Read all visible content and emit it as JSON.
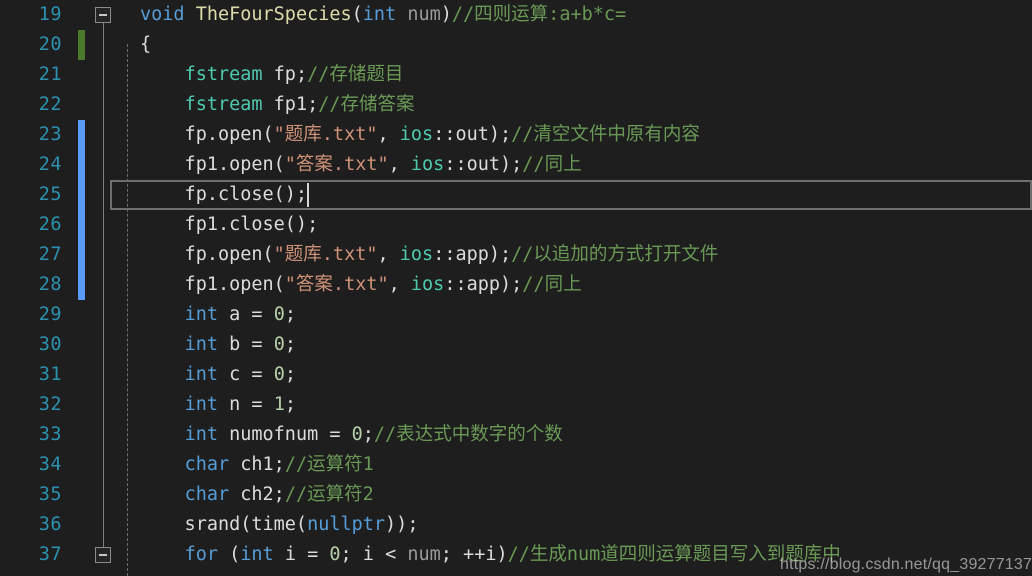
{
  "editor": {
    "theme_name": "dark",
    "background_color": "#1e1e1e",
    "line_number_color": "#2b91af",
    "comment_color": "#6a9955",
    "keyword_color": "#569cd6",
    "string_color": "#ce9178",
    "type_color": "#4ec9b0",
    "number_color": "#b5cea8",
    "change_bar_added_color": "#4b7a2c",
    "change_bar_modified_color": "#5b9bf8",
    "current_line_number": "25",
    "first_visible_line": "19",
    "last_visible_line": "37"
  },
  "gutter": {
    "line_numbers": [
      "19",
      "20",
      "21",
      "22",
      "23",
      "24",
      "25",
      "26",
      "27",
      "28",
      "29",
      "30",
      "31",
      "32",
      "33",
      "34",
      "35",
      "36",
      "37"
    ],
    "fold_markers": [
      {
        "line": "19",
        "state": "expanded",
        "glyph": "minus"
      },
      {
        "line": "37",
        "state": "expanded",
        "glyph": "minus"
      }
    ],
    "change_bars": [
      {
        "line": "20",
        "kind": "added",
        "color": "#4b7a2c"
      },
      {
        "line": "23",
        "kind": "modified",
        "color": "#5b9bf8"
      },
      {
        "line": "24",
        "kind": "modified",
        "color": "#5b9bf8"
      },
      {
        "line": "25",
        "kind": "modified",
        "color": "#5b9bf8"
      },
      {
        "line": "26",
        "kind": "modified",
        "color": "#5b9bf8"
      },
      {
        "line": "27",
        "kind": "modified",
        "color": "#5b9bf8"
      },
      {
        "line": "28",
        "kind": "modified",
        "color": "#5b9bf8"
      }
    ]
  },
  "code": {
    "lines": [
      {
        "number": "19",
        "text": "void TheFourSpecies(int num)//四则运算:a+b*c=",
        "tokens": [
          {
            "t": "void",
            "c": "kw"
          },
          {
            "t": " ",
            "c": "pun"
          },
          {
            "t": "TheFourSpecies",
            "c": "fn"
          },
          {
            "t": "(",
            "c": "pun"
          },
          {
            "t": "int",
            "c": "kw"
          },
          {
            "t": " ",
            "c": "pun"
          },
          {
            "t": "num",
            "c": "par"
          },
          {
            "t": ")",
            "c": "pun"
          },
          {
            "t": "//四则运算:a+b*c=",
            "c": "cmt"
          }
        ]
      },
      {
        "number": "20",
        "text": "{",
        "tokens": [
          {
            "t": "{",
            "c": "pun"
          }
        ]
      },
      {
        "number": "21",
        "text": "    fstream fp;//存储题目",
        "tokens": [
          {
            "t": "    ",
            "c": "pun"
          },
          {
            "t": "fstream",
            "c": "typ"
          },
          {
            "t": " fp;",
            "c": "pun"
          },
          {
            "t": "//存储题目",
            "c": "cmt"
          }
        ]
      },
      {
        "number": "22",
        "text": "    fstream fp1;//存储答案",
        "tokens": [
          {
            "t": "    ",
            "c": "pun"
          },
          {
            "t": "fstream",
            "c": "typ"
          },
          {
            "t": " fp1;",
            "c": "pun"
          },
          {
            "t": "//存储答案",
            "c": "cmt"
          }
        ]
      },
      {
        "number": "23",
        "text": "    fp.open(\"题库.txt\", ios::out);//清空文件中原有内容",
        "tokens": [
          {
            "t": "    fp.open(",
            "c": "pun"
          },
          {
            "t": "\"题库.txt\"",
            "c": "str"
          },
          {
            "t": ", ",
            "c": "pun"
          },
          {
            "t": "ios",
            "c": "typ"
          },
          {
            "t": "::out);",
            "c": "pun"
          },
          {
            "t": "//清空文件中原有内容",
            "c": "cmt"
          }
        ]
      },
      {
        "number": "24",
        "text": "    fp1.open(\"答案.txt\", ios::out);//同上",
        "tokens": [
          {
            "t": "    fp1.open(",
            "c": "pun"
          },
          {
            "t": "\"答案.txt\"",
            "c": "str"
          },
          {
            "t": ", ",
            "c": "pun"
          },
          {
            "t": "ios",
            "c": "typ"
          },
          {
            "t": "::out);",
            "c": "pun"
          },
          {
            "t": "//同上",
            "c": "cmt"
          }
        ]
      },
      {
        "number": "25",
        "text": "    fp.close();",
        "tokens": [
          {
            "t": "    fp.close();",
            "c": "pun"
          }
        ]
      },
      {
        "number": "26",
        "text": "    fp1.close();",
        "tokens": [
          {
            "t": "    fp1.close();",
            "c": "pun"
          }
        ]
      },
      {
        "number": "27",
        "text": "    fp.open(\"题库.txt\", ios::app);//以追加的方式打开文件",
        "tokens": [
          {
            "t": "    fp.open(",
            "c": "pun"
          },
          {
            "t": "\"题库.txt\"",
            "c": "str"
          },
          {
            "t": ", ",
            "c": "pun"
          },
          {
            "t": "ios",
            "c": "typ"
          },
          {
            "t": "::app);",
            "c": "pun"
          },
          {
            "t": "//以追加的方式打开文件",
            "c": "cmt"
          }
        ]
      },
      {
        "number": "28",
        "text": "    fp1.open(\"答案.txt\", ios::app);//同上",
        "tokens": [
          {
            "t": "    fp1.open(",
            "c": "pun"
          },
          {
            "t": "\"答案.txt\"",
            "c": "str"
          },
          {
            "t": ", ",
            "c": "pun"
          },
          {
            "t": "ios",
            "c": "typ"
          },
          {
            "t": "::app);",
            "c": "pun"
          },
          {
            "t": "//同上",
            "c": "cmt"
          }
        ]
      },
      {
        "number": "29",
        "text": "    int a = 0;",
        "tokens": [
          {
            "t": "    ",
            "c": "pun"
          },
          {
            "t": "int",
            "c": "kw"
          },
          {
            "t": " a = ",
            "c": "pun"
          },
          {
            "t": "0",
            "c": "num"
          },
          {
            "t": ";",
            "c": "pun"
          }
        ]
      },
      {
        "number": "30",
        "text": "    int b = 0;",
        "tokens": [
          {
            "t": "    ",
            "c": "pun"
          },
          {
            "t": "int",
            "c": "kw"
          },
          {
            "t": " b = ",
            "c": "pun"
          },
          {
            "t": "0",
            "c": "num"
          },
          {
            "t": ";",
            "c": "pun"
          }
        ]
      },
      {
        "number": "31",
        "text": "    int c = 0;",
        "tokens": [
          {
            "t": "    ",
            "c": "pun"
          },
          {
            "t": "int",
            "c": "kw"
          },
          {
            "t": " c = ",
            "c": "pun"
          },
          {
            "t": "0",
            "c": "num"
          },
          {
            "t": ";",
            "c": "pun"
          }
        ]
      },
      {
        "number": "32",
        "text": "    int n = 1;",
        "tokens": [
          {
            "t": "    ",
            "c": "pun"
          },
          {
            "t": "int",
            "c": "kw"
          },
          {
            "t": " n = ",
            "c": "pun"
          },
          {
            "t": "1",
            "c": "num"
          },
          {
            "t": ";",
            "c": "pun"
          }
        ]
      },
      {
        "number": "33",
        "text": "    int numofnum = 0;//表达式中数字的个数",
        "tokens": [
          {
            "t": "    ",
            "c": "pun"
          },
          {
            "t": "int",
            "c": "kw"
          },
          {
            "t": " numofnum = ",
            "c": "pun"
          },
          {
            "t": "0",
            "c": "num"
          },
          {
            "t": ";",
            "c": "pun"
          },
          {
            "t": "//表达式中数字的个数",
            "c": "cmt"
          }
        ]
      },
      {
        "number": "34",
        "text": "    char ch1;//运算符1",
        "tokens": [
          {
            "t": "    ",
            "c": "pun"
          },
          {
            "t": "char",
            "c": "kw"
          },
          {
            "t": " ch1;",
            "c": "pun"
          },
          {
            "t": "//运算符1",
            "c": "cmt"
          }
        ]
      },
      {
        "number": "35",
        "text": "    char ch2;//运算符2",
        "tokens": [
          {
            "t": "    ",
            "c": "pun"
          },
          {
            "t": "char",
            "c": "kw"
          },
          {
            "t": " ch2;",
            "c": "pun"
          },
          {
            "t": "//运算符2",
            "c": "cmt"
          }
        ]
      },
      {
        "number": "36",
        "text": "    srand(time(nullptr));",
        "tokens": [
          {
            "t": "    srand(time(",
            "c": "pun"
          },
          {
            "t": "nullptr",
            "c": "kw"
          },
          {
            "t": "));",
            "c": "pun"
          }
        ]
      },
      {
        "number": "37",
        "text": "    for (int i = 0; i < num; ++i)//生成num道四则运算题目写入到题库中",
        "tokens": [
          {
            "t": "    ",
            "c": "pun"
          },
          {
            "t": "for",
            "c": "kw"
          },
          {
            "t": " (",
            "c": "pun"
          },
          {
            "t": "int",
            "c": "kw"
          },
          {
            "t": " i = ",
            "c": "pun"
          },
          {
            "t": "0",
            "c": "num"
          },
          {
            "t": "; i < ",
            "c": "pun"
          },
          {
            "t": "num",
            "c": "par"
          },
          {
            "t": "; ++i)",
            "c": "pun"
          },
          {
            "t": "//生成num道四则运算题目写入到题库中",
            "c": "cmt"
          }
        ]
      }
    ]
  },
  "watermark": {
    "text": "https://blog.csdn.net/qq_39277137"
  }
}
